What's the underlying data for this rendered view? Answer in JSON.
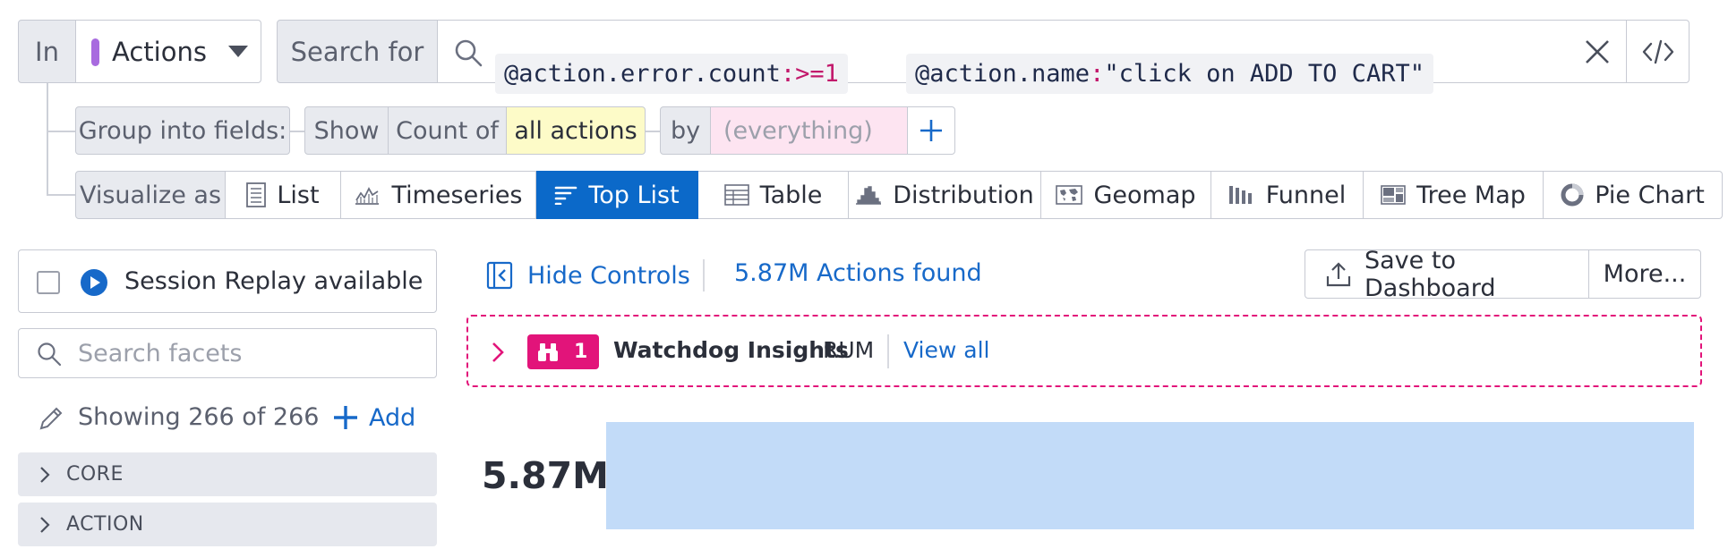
{
  "query_bar": {
    "in_label": "In",
    "source_label": "Actions",
    "source_color": "#a86bdf",
    "search_for_label": "Search for",
    "token1_attr": "@action.error.count",
    "token1_op": ":>=1",
    "token2_attr": "@action.name",
    "token2_op": ":",
    "token2_value": "\"click on ADD TO CART\""
  },
  "group": {
    "label": "Group into fields:",
    "show_label": "Show",
    "count_of_label": "Count of",
    "measure_value": "all actions",
    "by_label": "by",
    "by_placeholder": "(everything)",
    "add_icon": "plus-icon"
  },
  "visualize": {
    "label": "Visualize as",
    "options": [
      {
        "label": "List",
        "icon": "list-icon"
      },
      {
        "label": "Timeseries",
        "icon": "timeseries-icon"
      },
      {
        "label": "Top List",
        "icon": "toplist-icon",
        "selected": true
      },
      {
        "label": "Table",
        "icon": "table-icon"
      },
      {
        "label": "Distribution",
        "icon": "distribution-icon"
      },
      {
        "label": "Geomap",
        "icon": "geomap-icon"
      },
      {
        "label": "Funnel",
        "icon": "funnel-icon"
      },
      {
        "label": "Tree Map",
        "icon": "treemap-icon"
      },
      {
        "label": "Pie Chart",
        "icon": "piechart-icon"
      }
    ]
  },
  "sidebar": {
    "session_replay_label": "Session Replay available",
    "search_placeholder": "Search facets",
    "showing_text": "Showing 266 of 266",
    "add_label": "Add",
    "facet_groups": [
      "CORE",
      "ACTION"
    ]
  },
  "controls": {
    "hide_controls_label": "Hide Controls",
    "results_text": "5.87M Actions found",
    "save_label": "Save to Dashboard",
    "more_label": "More..."
  },
  "watchdog": {
    "count": "1",
    "title": "Watchdog Insights",
    "product": "RUM",
    "view_all_label": "View all",
    "accent_color": "#e2147a"
  },
  "chart_data": {
    "type": "bar",
    "categories": [
      ""
    ],
    "values": [
      5.87
    ],
    "value_label": "5.87M",
    "bar_color": "#c2dbf8"
  }
}
